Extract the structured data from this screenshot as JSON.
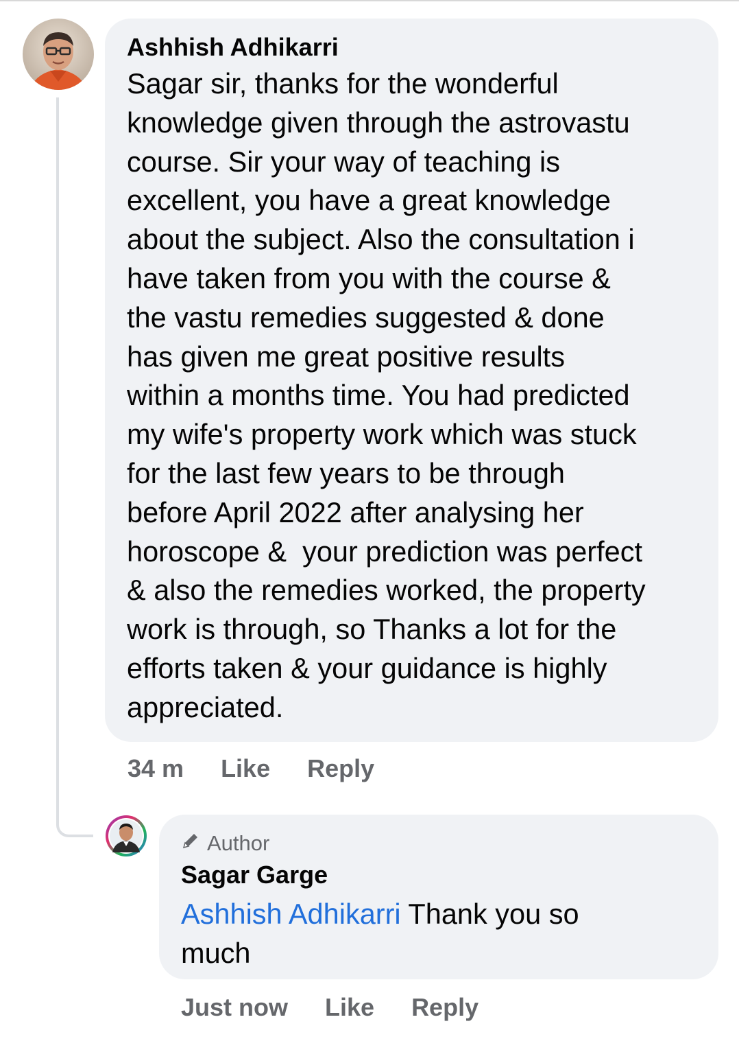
{
  "comment": {
    "author": "Ashhish Adhikarri",
    "avatar_icon": "profile-photo-icon",
    "lines": [
      "Sagar sir, thanks for the wonderful",
      "knowledge given through the astrovastu",
      "course. Sir your way of teaching is",
      "excellent, you have a great knowledge",
      "about the subject. Also the consultation i",
      "have taken from you with the course &",
      "the vastu remedies suggested & done",
      "has given me great positive results",
      "within a months time. You had predicted",
      "my wife's property work which was stuck",
      "for the last few years to be through",
      "before April 2022 after analysing her",
      "horoscope &  your prediction was perfect",
      "& also the remedies worked, the property",
      "work is through, so Thanks a lot for the",
      "efforts taken & your guidance is highly",
      "appreciated."
    ],
    "time": "34 m",
    "like_label": "Like",
    "reply_label": "Reply"
  },
  "reply": {
    "badge_icon": "pencil-icon",
    "badge_label": "Author",
    "author": "Sagar Garge",
    "avatar_icon": "profile-photo-icon",
    "mention": "Ashhish Adhikarri",
    "text_line1": " Thank you so",
    "text_line2": "much",
    "time": "Just now",
    "like_label": "Like",
    "reply_label": "Reply"
  },
  "colors": {
    "bubble": "#f0f2f5",
    "meta_text": "#65676b",
    "mention": "#216fdb"
  }
}
